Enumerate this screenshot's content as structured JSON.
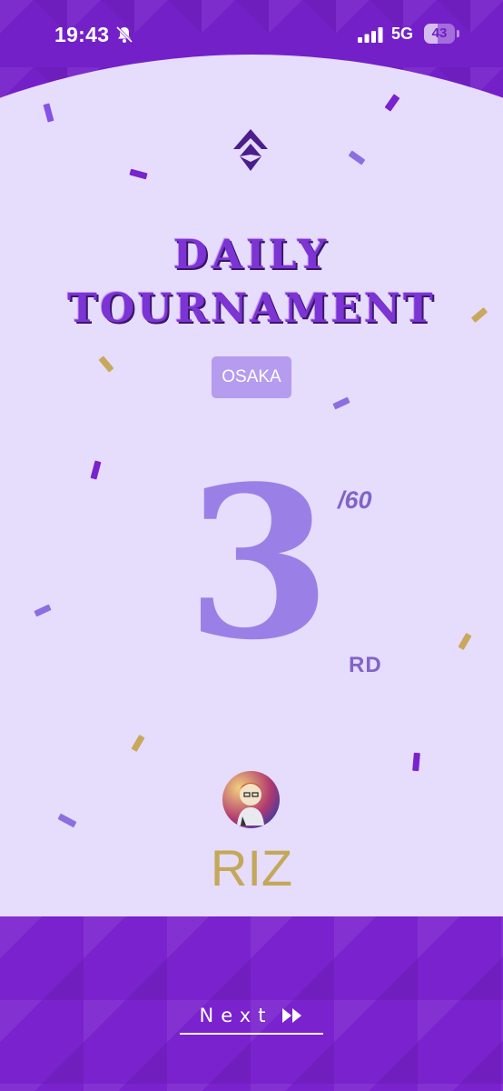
{
  "status_bar": {
    "time": "19:43",
    "network": "5G",
    "battery": "43",
    "battery_level": 0.43
  },
  "tournament": {
    "title_line1": "DAILY",
    "title_line2": "TOURNAMENT",
    "venue": "OSAKA"
  },
  "result": {
    "rank": "3",
    "total": "/60",
    "suffix": "RD"
  },
  "player": {
    "name": "RIZ"
  },
  "footer": {
    "next_label": "Next"
  },
  "colors": {
    "band": "#7420c9",
    "card": "#e6dcfb",
    "accent": "#9a80e6",
    "gold": "#c3a85a"
  }
}
